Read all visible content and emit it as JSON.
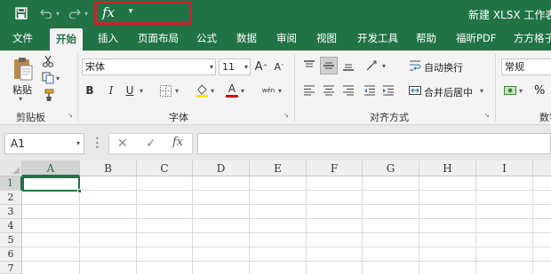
{
  "quick_access": {
    "fx_label": "fx",
    "customize_glyph": "▾"
  },
  "document_title": "新建 XLSX 工作表.x",
  "tabs": [
    {
      "label": "文件"
    },
    {
      "label": "开始"
    },
    {
      "label": "插入"
    },
    {
      "label": "页面布局"
    },
    {
      "label": "公式"
    },
    {
      "label": "数据"
    },
    {
      "label": "审阅"
    },
    {
      "label": "视图"
    },
    {
      "label": "开发工具"
    },
    {
      "label": "帮助"
    },
    {
      "label": "福昕PDF"
    },
    {
      "label": "方方格子"
    }
  ],
  "ribbon": {
    "clipboard": {
      "label": "剪贴板",
      "paste_label": "粘贴"
    },
    "font": {
      "label": "字体",
      "font_name": "宋体",
      "font_size": "11",
      "bold": "B",
      "italic": "I",
      "underline": "U",
      "grow": "A",
      "shrink": "A",
      "font_color_letter": "A",
      "phonetic": "wén"
    },
    "alignment": {
      "label": "对齐方式",
      "wrap_text": "自动换行",
      "merge_center": "合并后居中"
    },
    "number": {
      "label": "数字",
      "format": "常规",
      "percent": "%"
    }
  },
  "formula_bar": {
    "name_box": "A1",
    "cancel_glyph": "✕",
    "enter_glyph": "✓",
    "fx_label": "fx",
    "formula": ""
  },
  "sheet": {
    "columns": [
      "A",
      "B",
      "C",
      "D",
      "E",
      "F",
      "G",
      "H",
      "I"
    ],
    "rows": [
      "1",
      "2",
      "3",
      "4",
      "5",
      "6",
      "7"
    ],
    "active_cell": "A1"
  },
  "colors": {
    "brand": "#217346",
    "highlight": "#c8242f"
  }
}
